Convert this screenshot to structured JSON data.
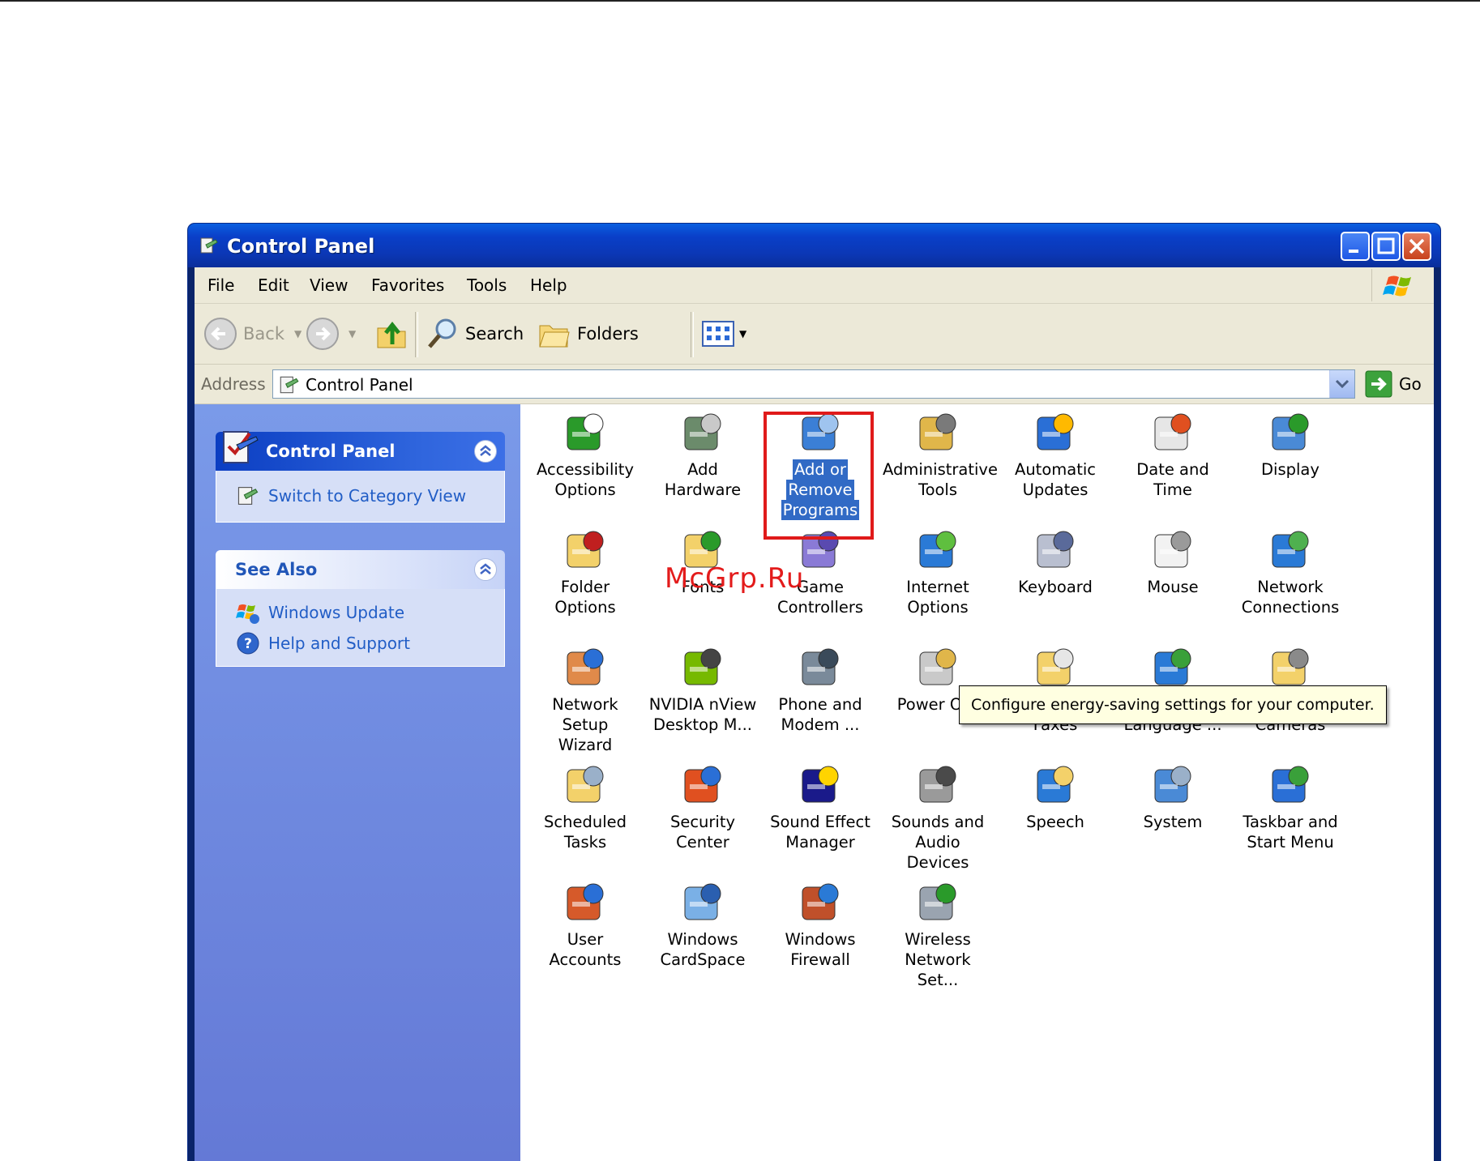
{
  "window": {
    "title": "Control Panel"
  },
  "menu": [
    {
      "key": "F",
      "rest": "ile"
    },
    {
      "key": "E",
      "rest": "dit"
    },
    {
      "key": "V",
      "rest": "iew"
    },
    {
      "key": "F",
      "pre": "",
      "rest": "avorites",
      "label": "Favorites"
    },
    {
      "key": "T",
      "rest": "ools"
    },
    {
      "key": "H",
      "rest": "elp"
    }
  ],
  "menu_labels": [
    "File",
    "Edit",
    "View",
    "Favorites",
    "Tools",
    "Help"
  ],
  "toolbar": {
    "back": "Back",
    "search": "Search",
    "folders": "Folders"
  },
  "address": {
    "label": "Address",
    "value": "Control Panel",
    "go": "Go"
  },
  "sidebar": {
    "main_title": "Control Panel",
    "switch_link": "Switch to Category View",
    "see_also_title": "See Also",
    "see_also": [
      "Windows Update",
      "Help and Support"
    ]
  },
  "items": [
    {
      "l1": "Accessibility",
      "l2": "Options",
      "icon": "accessibility-icon"
    },
    {
      "l1": "Add Hardware",
      "l2": "",
      "icon": "add-hardware-icon"
    },
    {
      "l1": "Add or",
      "l2": "Remove",
      "l3": "Programs",
      "icon": "add-remove-programs-icon",
      "selected": true
    },
    {
      "l1": "Administrative",
      "l2": "Tools",
      "icon": "administrative-tools-icon"
    },
    {
      "l1": "Automatic",
      "l2": "Updates",
      "icon": "automatic-updates-icon"
    },
    {
      "l1": "Date and Time",
      "l2": "",
      "icon": "date-time-icon"
    },
    {
      "l1": "Display",
      "l2": "",
      "icon": "display-icon"
    },
    {
      "l1": "Folder Options",
      "l2": "",
      "icon": "folder-options-icon"
    },
    {
      "l1": "Fonts",
      "l2": "",
      "icon": "fonts-icon"
    },
    {
      "l1": "Game",
      "l2": "Controllers",
      "icon": "game-controllers-icon"
    },
    {
      "l1": "Internet",
      "l2": "Options",
      "icon": "internet-options-icon"
    },
    {
      "l1": "Keyboard",
      "l2": "",
      "icon": "keyboard-icon"
    },
    {
      "l1": "Mouse",
      "l2": "",
      "icon": "mouse-icon"
    },
    {
      "l1": "Network",
      "l2": "Connections",
      "icon": "network-connections-icon"
    },
    {
      "l1": "Network Setup",
      "l2": "Wizard",
      "icon": "network-setup-icon"
    },
    {
      "l1": "NVIDIA nView",
      "l2": "Desktop M...",
      "icon": "nvidia-icon"
    },
    {
      "l1": "Phone and",
      "l2": "Modem ...",
      "icon": "phone-modem-icon"
    },
    {
      "l1": "Power Opt",
      "l2": "",
      "icon": "power-options-icon"
    },
    {
      "l1": "",
      "l2": "Faxes",
      "icon": "printers-faxes-icon"
    },
    {
      "l1": "",
      "l2": "Language ...",
      "icon": "regional-language-icon"
    },
    {
      "l1": "",
      "l2": "Cameras",
      "icon": "scanners-cameras-icon"
    },
    {
      "l1": "Scheduled",
      "l2": "Tasks",
      "icon": "scheduled-tasks-icon"
    },
    {
      "l1": "Security",
      "l2": "Center",
      "icon": "security-center-icon"
    },
    {
      "l1": "Sound Effect",
      "l2": "Manager",
      "icon": "sound-effect-icon"
    },
    {
      "l1": "Sounds and",
      "l2": "Audio Devices",
      "icon": "sounds-audio-icon"
    },
    {
      "l1": "Speech",
      "l2": "",
      "icon": "speech-icon"
    },
    {
      "l1": "System",
      "l2": "",
      "icon": "system-icon"
    },
    {
      "l1": "Taskbar and",
      "l2": "Start Menu",
      "icon": "taskbar-icon"
    },
    {
      "l1": "User Accounts",
      "l2": "",
      "icon": "user-accounts-icon"
    },
    {
      "l1": "Windows",
      "l2": "CardSpace",
      "icon": "cardspace-icon"
    },
    {
      "l1": "Windows",
      "l2": "Firewall",
      "icon": "firewall-icon"
    },
    {
      "l1": "Wireless",
      "l2": "Network Set...",
      "icon": "wireless-icon"
    }
  ],
  "tooltip": "Configure energy-saving settings for your computer.",
  "watermark": "McGrp.Ru"
}
